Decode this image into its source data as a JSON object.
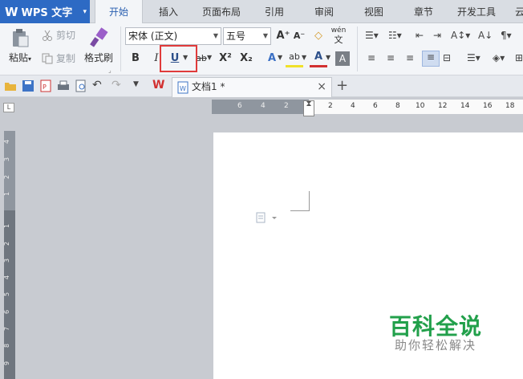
{
  "app": {
    "logo": "W",
    "name": "WPS 文字",
    "caret": "▾"
  },
  "menu": [
    {
      "label": "开始",
      "active": true
    },
    {
      "label": "插入"
    },
    {
      "label": "页面布局"
    },
    {
      "label": "引用"
    },
    {
      "label": "审阅"
    },
    {
      "label": "视图"
    },
    {
      "label": "章节"
    },
    {
      "label": "开发工具"
    },
    {
      "label": "云"
    }
  ],
  "ribbon": {
    "paste_label": "粘贴",
    "paste_caret": "▾",
    "cut_label": "剪切",
    "copy_label": "复制",
    "format_painter_label": "格式刷",
    "font_name": "宋体 (正文)",
    "font_size": "五号",
    "bold": "B",
    "italic": "I",
    "underline": "U",
    "strike": "ab",
    "superscript": "X²",
    "subscript": "X₂",
    "grow_font": "A⁺",
    "shrink_font": "A⁻",
    "phonetic": "wén",
    "text_effect": "A",
    "font_color": "A",
    "shade": "A",
    "highlight": "ab"
  },
  "doc_tab": {
    "title": "文档1 *",
    "close": "×",
    "new_tab": "+"
  },
  "ruler": {
    "corner": "L",
    "h_numbers": [
      "6",
      "4",
      "2",
      "2",
      "4",
      "6",
      "8",
      "10",
      "12",
      "14",
      "16",
      "18"
    ],
    "v_numbers": [
      "4",
      "3",
      "2",
      "1",
      "1",
      "2",
      "3",
      "4",
      "5",
      "6",
      "7",
      "8",
      "9"
    ]
  },
  "watermark": {
    "title": "百科全说",
    "subtitle": "助你轻松解决"
  },
  "colors": {
    "app_blue": "#2d6ac4",
    "highlight_red": "#e03b3b",
    "watermark_green": "#22a04b"
  }
}
